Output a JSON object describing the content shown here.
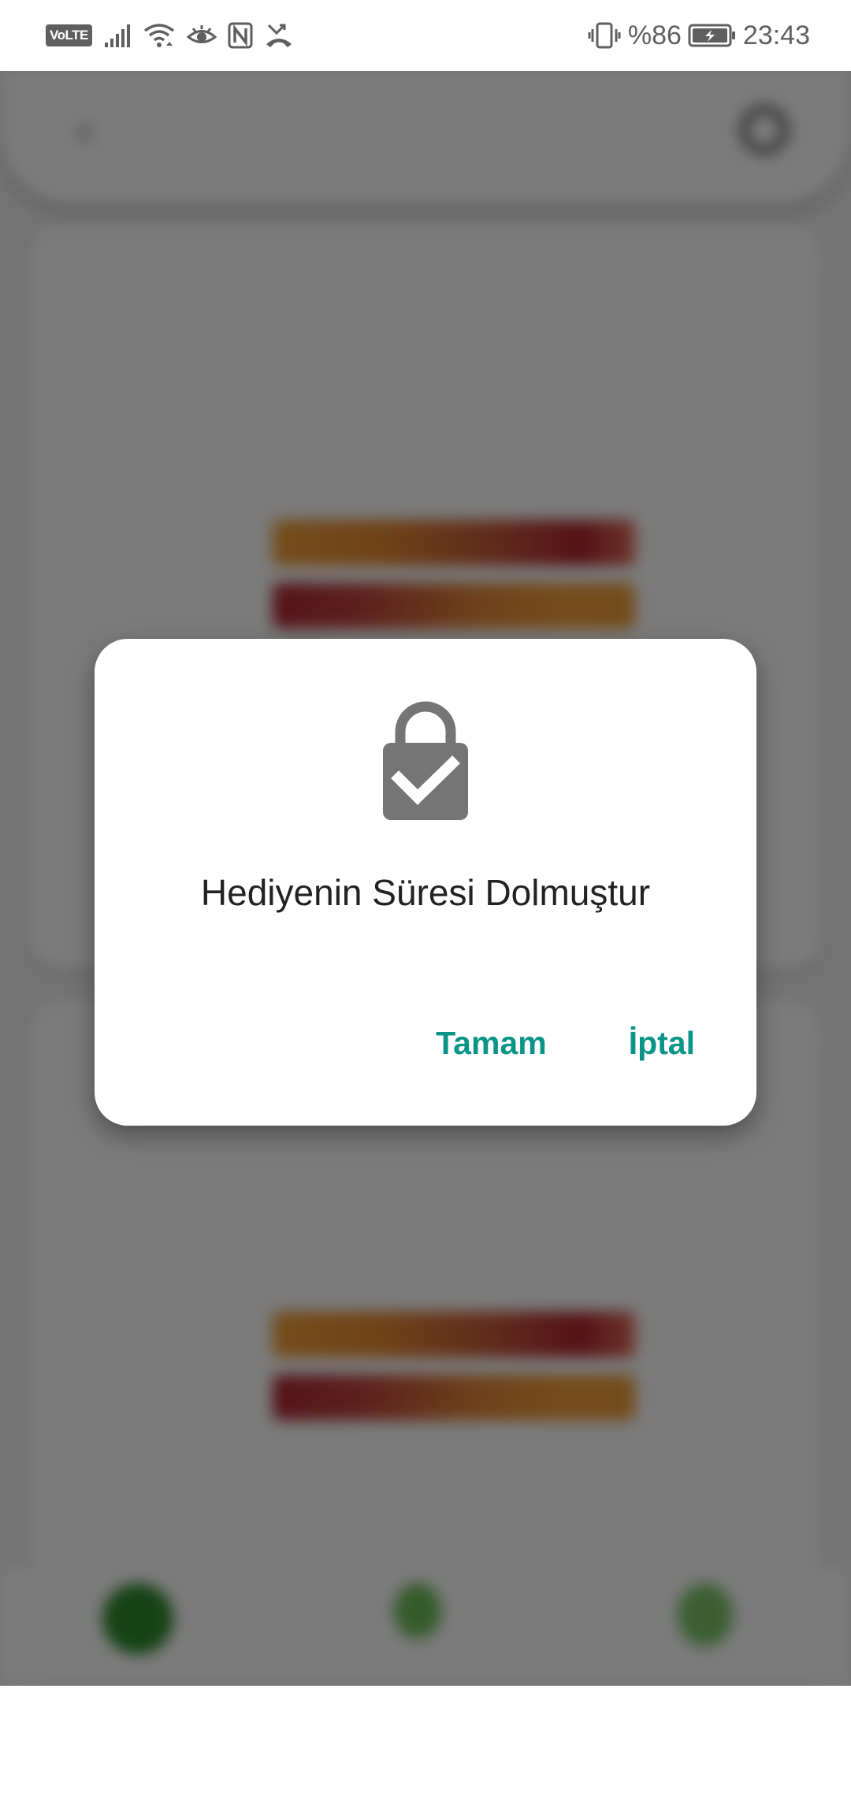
{
  "status_bar": {
    "volte_label": "VoLTE",
    "battery_text": "%86",
    "time": "23:43",
    "icons": [
      "volte-icon",
      "signal-icon",
      "wifi-icon",
      "eye-icon",
      "nfc-icon",
      "missed-call-icon",
      "vibrate-icon",
      "battery-icon"
    ]
  },
  "dialog": {
    "icon": "lock-check-icon",
    "message": "Hediyenin Süresi Dolmuştur",
    "confirm_label": "Tamam",
    "cancel_label": "İptal"
  },
  "colors": {
    "accent": "#0a9488",
    "icon_gray": "#757575",
    "scrim": "rgba(0,0,0,0.52)"
  }
}
